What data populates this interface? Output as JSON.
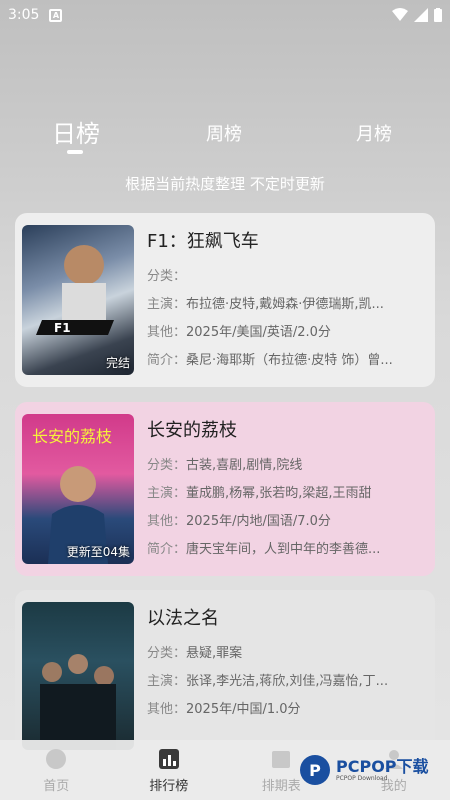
{
  "status": {
    "time": "3:05",
    "notif_icon": "a-notification-icon"
  },
  "tabs": [
    {
      "label": "日榜",
      "active": true
    },
    {
      "label": "周榜",
      "active": false
    },
    {
      "label": "月榜",
      "active": false
    }
  ],
  "subtitle": "根据当前热度整理 不定时更新",
  "items": [
    {
      "title": "F1：狂飙飞车",
      "genre_label": "分类：",
      "genre": "",
      "cast_label": "主演：",
      "cast": "布拉德·皮特,戴姆森·伊德瑞斯,凯...",
      "other_label": "其他：",
      "other": "2025年/美国/英语/2.0分",
      "intro_label": "简介：",
      "intro": "桑尼·海耶斯（布拉德·皮特 饰）曾...",
      "badge": "完结",
      "colors": {
        "card": "#eeeeee"
      }
    },
    {
      "title": "长安的荔枝",
      "genre_label": "分类：",
      "genre": "古装,喜剧,剧情,院线",
      "cast_label": "主演：",
      "cast": "董成鹏,杨幂,张若昀,梁超,王雨甜",
      "other_label": "其他：",
      "other": "2025年/内地/国语/7.0分",
      "intro_label": "简介：",
      "intro": "唐天宝年间，人到中年的李善德...",
      "badge": "更新至04集",
      "colors": {
        "card": "#f2d3e3"
      }
    },
    {
      "title": "以法之名",
      "genre_label": "分类：",
      "genre": "悬疑,罪案",
      "cast_label": "主演：",
      "cast": "张译,李光洁,蒋欣,刘佳,冯嘉怡,丁...",
      "other_label": "其他：",
      "other": "2025年/中国/1.0分",
      "intro_label": "",
      "intro": "",
      "badge": "",
      "colors": {
        "card": "#e5e5e5"
      }
    }
  ],
  "nav": [
    {
      "label": "首页",
      "icon": "home-icon"
    },
    {
      "label": "排行榜",
      "icon": "ranking-icon"
    },
    {
      "label": "排期表",
      "icon": "calendar-icon"
    },
    {
      "label": "我的",
      "icon": "user-icon"
    }
  ],
  "watermark": {
    "logo": "P",
    "text": "PCPOP下载",
    "sub": "PCPOP Download"
  }
}
